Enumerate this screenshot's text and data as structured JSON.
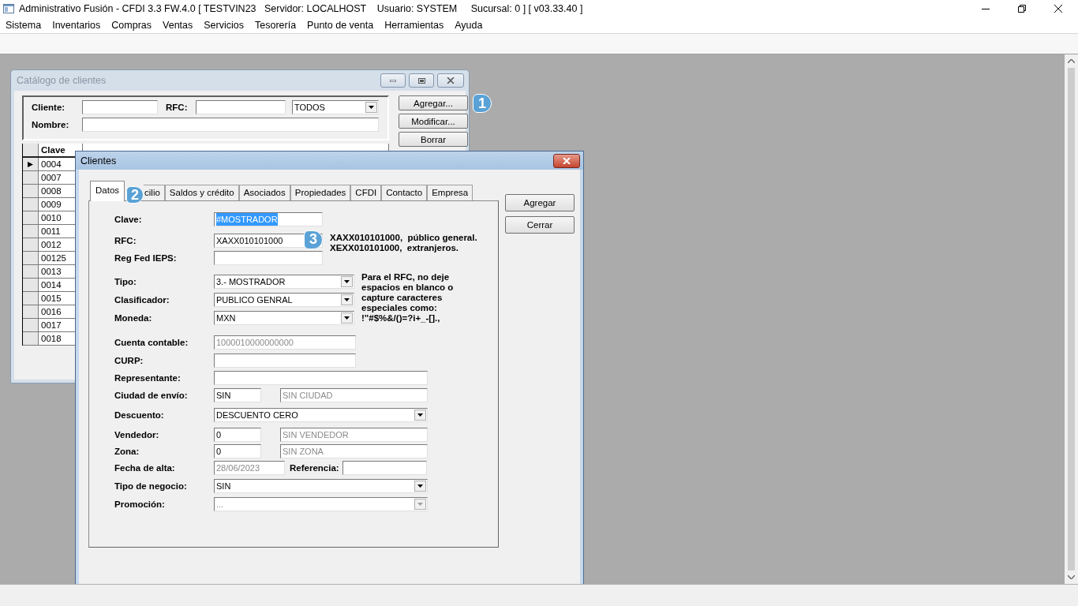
{
  "app_window": {
    "title": "Administrativo Fusión - CFDI 3.3 FW.4.0 [ TESTVIN23   Servidor: LOCALHOST    Usuario: SYSTEM     Sucursal: 0 ] [ v03.33.40 ]",
    "menu": [
      "Sistema",
      "Inventarios",
      "Compras",
      "Ventas",
      "Servicios",
      "Tesorería",
      "Punto de venta",
      "Herramientas",
      "Ayuda"
    ]
  },
  "catalog_window": {
    "title": "Catálogo de clientes",
    "filters": {
      "cliente_label": "Cliente:",
      "rfc_label": "RFC:",
      "tipo_value": "TODOS",
      "nombre_label": "Nombre:"
    },
    "grid": {
      "columns": [
        "Clave"
      ],
      "rows": [
        {
          "clave": "0004",
          "selected": true
        },
        {
          "clave": "0007",
          "selected": false
        },
        {
          "clave": "0008",
          "selected": false
        },
        {
          "clave": "0009",
          "selected": false
        },
        {
          "clave": "0010",
          "selected": false
        },
        {
          "clave": "0011",
          "selected": false
        },
        {
          "clave": "0012",
          "selected": false
        },
        {
          "clave": "00125",
          "selected": false
        },
        {
          "clave": "0013",
          "selected": false
        },
        {
          "clave": "0014",
          "selected": false
        },
        {
          "clave": "0015",
          "selected": false
        },
        {
          "clave": "0016",
          "selected": false
        },
        {
          "clave": "0017",
          "selected": false
        },
        {
          "clave": "0018",
          "selected": false
        }
      ]
    },
    "buttons": [
      {
        "label": "Agregar...",
        "badge": "1"
      },
      {
        "label": "Modificar..."
      },
      {
        "label": "Borrar"
      }
    ]
  },
  "clientes_dialog": {
    "title": "Clientes",
    "tabs": [
      {
        "label": "Datos",
        "selected": true
      },
      {
        "label": "cilio",
        "selected": false,
        "badge": "2"
      },
      {
        "label": "Saldos y crédito",
        "selected": false
      },
      {
        "label": "Asociados",
        "selected": false
      },
      {
        "label": "Propiedades",
        "selected": false
      },
      {
        "label": "CFDI",
        "selected": false
      },
      {
        "label": "Contacto",
        "selected": false
      },
      {
        "label": "Empresa",
        "selected": false
      }
    ],
    "buttons": [
      "Agregar",
      "Cerrar"
    ],
    "form": {
      "clave": {
        "label": "Clave:",
        "value": "#MOSTRADOR",
        "highlighted": true
      },
      "rfc": {
        "label": "RFC:",
        "value": "XAXX010101000",
        "badge": "3"
      },
      "rfc_examples": [
        "XAXX010101000,  público general.",
        "XEXX010101000,  extranjeros."
      ],
      "reg_fed_ieps": {
        "label": "Reg Fed IEPS:"
      },
      "tipo": {
        "label": "Tipo:",
        "value": "3.- MOSTRADOR"
      },
      "clasificador": {
        "label": "Clasificador:",
        "value": "PUBLICO GENRAL"
      },
      "moneda": {
        "label": "Moneda:",
        "value": "MXN"
      },
      "rfc_warning": "Para el RFC, no deje espacios en blanco o capture caracteres especiales como: !\"#$%&/()=?i+_-[].,",
      "cuenta_contable": {
        "label": "Cuenta contable:",
        "value": "1000010000000000",
        "disabled": true
      },
      "curp": {
        "label": "CURP:"
      },
      "representante": {
        "label": "Representante:"
      },
      "ciudad_envio": {
        "label": "Ciudad de envío:",
        "code": "SIN",
        "name": "SIN CIUDAD"
      },
      "descuento": {
        "label": "Descuento:",
        "value": "DESCUENTO CERO"
      },
      "vendedor": {
        "label": "Vendedor:",
        "code": "0",
        "name": "SIN VENDEDOR"
      },
      "zona": {
        "label": "Zona:",
        "code": "0",
        "name": "SIN ZONA"
      },
      "fecha_alta": {
        "label": "Fecha de alta:",
        "value": "28/06/2023",
        "disabled": true
      },
      "referencia": {
        "label": "Referencia:"
      },
      "tipo_negocio": {
        "label": "Tipo de negocio:",
        "value": "SIN"
      },
      "promocion": {
        "label": "Promoción:",
        "value": "...",
        "disabled": true
      }
    }
  }
}
